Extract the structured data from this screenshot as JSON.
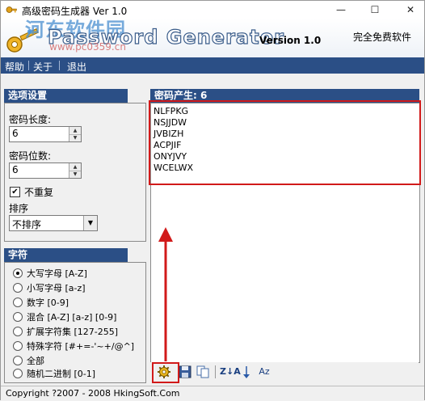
{
  "window": {
    "title": "高级密码生成器 Ver 1.0",
    "controls": {
      "minimize": "—",
      "maximize": "☐",
      "close": "✕"
    }
  },
  "banner": {
    "logo_text": "Password Generator",
    "version": "Version 1.0",
    "free_label": "完全免费软件",
    "watermark_site": "河东软件园",
    "watermark_url": "www.pc0359.cn"
  },
  "menu": {
    "items": [
      "帮助",
      "关于",
      "退出"
    ]
  },
  "options": {
    "header": "选项设置",
    "length_label": "密码长度:",
    "length_value": "6",
    "count_label": "密码位数:",
    "count_value": "6",
    "no_repeat_label": "不重复",
    "no_repeat_checked": true,
    "sort_label": "排序",
    "sort_value": "不排序"
  },
  "charset": {
    "header": "字符",
    "options": [
      {
        "label": "大写字母 [A-Z]",
        "selected": true
      },
      {
        "label": "小写字母 [a-z]",
        "selected": false
      },
      {
        "label": "数字 [0-9]",
        "selected": false
      },
      {
        "label": "混合 [A-Z] [a-z] [0-9]",
        "selected": false
      },
      {
        "label": "扩展字符集 [127-255]",
        "selected": false
      },
      {
        "label": "特殊字符 [#+=-'~+/@^]",
        "selected": false
      },
      {
        "label": "全部",
        "selected": false
      },
      {
        "label": "随机二进制 [0-1]",
        "selected": false
      }
    ]
  },
  "output": {
    "header": "密码产生: 6",
    "passwords": [
      "NLFPKG",
      "NSJJDW",
      "JVBIZH",
      "ACPJIF",
      "ONYJVY",
      "WCELWX"
    ]
  },
  "toolbar": {
    "sort_desc_label": "Z↓A",
    "az_label": "Az"
  },
  "status": {
    "copyright": "Copyright ?2007 - 2008 HkingSoft.Com"
  },
  "colors": {
    "accent": "#2b4f86",
    "highlight": "#d11a1a"
  }
}
